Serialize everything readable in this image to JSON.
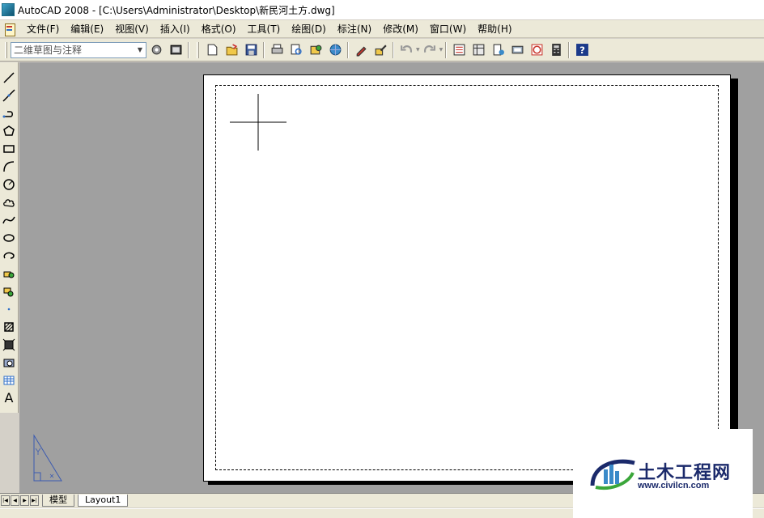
{
  "window": {
    "title": "AutoCAD 2008 - [C:\\Users\\Administrator\\Desktop\\新民河土方.dwg]"
  },
  "menu": {
    "items": [
      "文件(F)",
      "编辑(E)",
      "视图(V)",
      "插入(I)",
      "格式(O)",
      "工具(T)",
      "绘图(D)",
      "标注(N)",
      "修改(M)",
      "窗口(W)",
      "帮助(H)"
    ]
  },
  "toolbar": {
    "workspace_value": "二维草图与注释",
    "buttons": [
      "workspace-settings-icon",
      "workspaces-icon",
      "new-icon",
      "open-icon",
      "save-icon",
      "plot-icon",
      "plot-preview-icon",
      "publish-icon",
      "3d-dwf-icon",
      "match-properties-icon",
      "block-editor-icon",
      "undo-icon",
      "redo-icon",
      "properties-icon",
      "design-center-icon",
      "tool-palettes-icon",
      "sheet-set-icon",
      "markup-icon",
      "calculator-icon",
      "help-icon"
    ]
  },
  "draw_toolbar": {
    "tools": [
      "line-icon",
      "construction-line-icon",
      "polyline-icon",
      "polygon-icon",
      "rectangle-icon",
      "arc-icon",
      "circle-icon",
      "revision-cloud-icon",
      "spline-icon",
      "ellipse-icon",
      "ellipse-arc-icon",
      "insert-block-icon",
      "make-block-icon",
      "point-icon",
      "hatch-icon",
      "gradient-icon",
      "region-icon",
      "table-icon"
    ],
    "text_tool_label": "A"
  },
  "tabs": {
    "items": [
      "模型",
      "Layout1"
    ],
    "active": "Layout1"
  },
  "watermark": {
    "title": "土木工程网",
    "url": "www.civilcn.com"
  },
  "colors": {
    "canvas_bg": "#a0a0a0",
    "paper": "#ffffff",
    "chrome": "#ece9d8",
    "watermark_blue": "#1b2a6b",
    "watermark_green": "#3aa63a"
  }
}
